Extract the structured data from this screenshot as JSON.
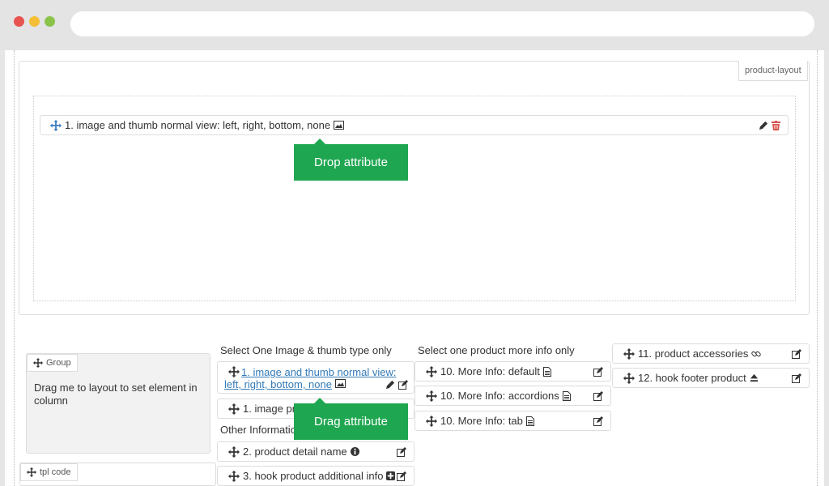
{
  "colors": {
    "accent": "#1fa651",
    "link": "#337ab7",
    "danger": "#d9534f"
  },
  "layout": {
    "tab_label": "product-layout",
    "dropped_item": {
      "label": "1. image and thumb normal view: left, right, bottom, none",
      "icon": "image-icon"
    }
  },
  "callouts": {
    "drop": "Drop attribute",
    "drag": "Drag attribute"
  },
  "group": {
    "tag": "Group",
    "text": "Drag me to layout to set element in column"
  },
  "tpl": {
    "tag": "tpl code"
  },
  "image_column": {
    "title": "Select One Image & thumb type only",
    "item1_line1": "1. image and thumb normal view:",
    "item1_line2": "left, right, bottom, none",
    "item2": "1. image pr",
    "other_title": "Other Information",
    "item3": "2. product detail name",
    "item4": "3. hook product additional info"
  },
  "moreinfo_column": {
    "title": "Select one product more info only",
    "items": [
      {
        "label": "10. More Info: default",
        "icon": "file-icon"
      },
      {
        "label": "10. More Info: accordions",
        "icon": "file-icon"
      },
      {
        "label": "10. More Info: tab",
        "icon": "file-icon"
      }
    ]
  },
  "right_column": {
    "items": [
      {
        "label": "11. product accessories",
        "icon": "link-icon"
      },
      {
        "label": "12. hook footer product",
        "icon": "eject-icon"
      }
    ]
  }
}
